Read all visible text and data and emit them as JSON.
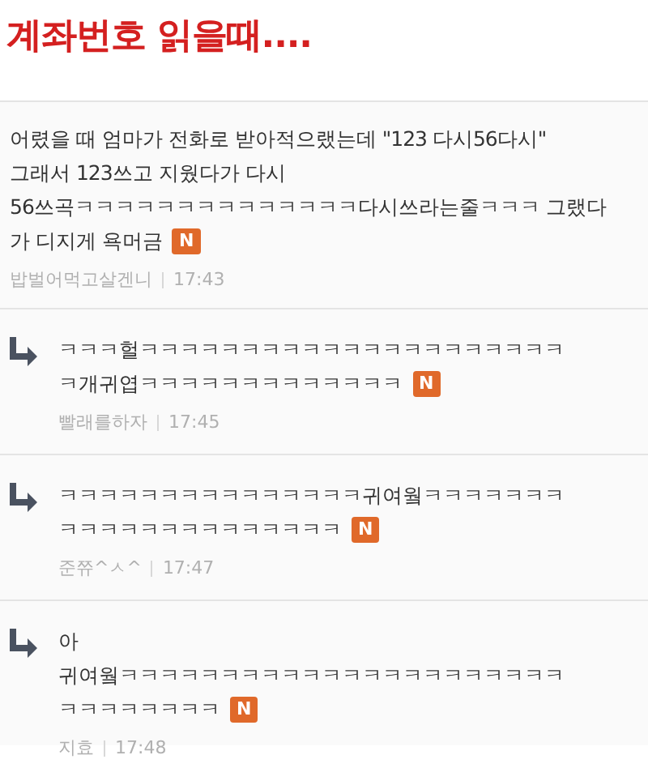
{
  "title": "계좌번호 읽을때....",
  "comments": [
    {
      "kind": "post",
      "lines": [
        "어렸을 때 엄마가 전화로 받아적으랬는데 \"123 다시56다시\"",
        "그래서 123쓰고 지웠다가 다시",
        "56쓰곡ㅋㅋㅋㅋㅋㅋㅋㅋㅋㅋㅋㅋㅋㅋ다시쓰라는줄ㅋㅋㅋ 그랬다",
        "가 디지게 욕머금"
      ],
      "badge": "N",
      "author": "밥벌어먹고살겐니",
      "time": "17:43"
    },
    {
      "kind": "reply",
      "lines": [
        "ㅋㅋㅋ헐ㅋㅋㅋㅋㅋㅋㅋㅋㅋㅋㅋㅋㅋㅋㅋㅋㅋㅋㅋㅋㅋ",
        "ㅋ개귀엽ㅋㅋㅋㅋㅋㅋㅋㅋㅋㅋㅋㅋㅋ"
      ],
      "badge": "N",
      "author": "빨래를하자",
      "time": "17:45"
    },
    {
      "kind": "reply",
      "lines": [
        "ㅋㅋㅋㅋㅋㅋㅋㅋㅋㅋㅋㅋㅋㅋㅋ귀여웤ㅋㅋㅋㅋㅋㅋㅋ",
        "ㅋㅋㅋㅋㅋㅋㅋㅋㅋㅋㅋㅋㅋㅋ"
      ],
      "badge": "N",
      "author": "준쮸^ㅅ^",
      "time": "17:47"
    },
    {
      "kind": "reply",
      "lines": [
        "아",
        "귀여웤ㅋㅋㅋㅋㅋㅋㅋㅋㅋㅋㅋㅋㅋㅋㅋㅋㅋㅋㅋㅋㅋㅋ",
        "ㅋㅋㅋㅋㅋㅋㅋㅋ"
      ],
      "badge": "N",
      "author": "지효",
      "time": "17:48"
    }
  ]
}
